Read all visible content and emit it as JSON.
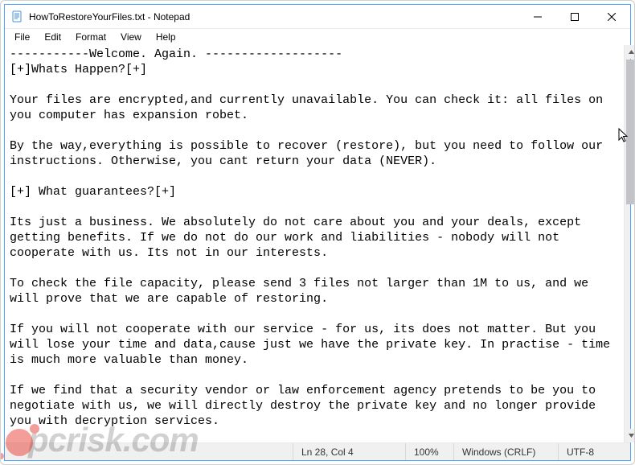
{
  "title": "HowToRestoreYourFiles.txt - Notepad",
  "menu": {
    "file": "File",
    "edit": "Edit",
    "format": "Format",
    "view": "View",
    "help": "Help"
  },
  "document_text": "-----------Welcome. Again. -------------------\n[+]Whats Happen?[+]\n\nYour files are encrypted,and currently unavailable. You can check it: all files on you computer has expansion robet.\n\nBy the way,everything is possible to recover (restore), but you need to follow our instructions. Otherwise, you cant return your data (NEVER).\n\n[+] What guarantees?[+]\n\nIts just a business. We absolutely do not care about you and your deals, except getting benefits. If we do not do our work and liabilities - nobody will not cooperate with us. Its not in our interests.\n\nTo check the file capacity, please send 3 files not larger than 1M to us, and we will prove that we are capable of restoring.\n\nIf you will not cooperate with our service - for us, its does not matter. But you will lose your time and data,cause just we have the private key. In practise - time is much more valuable than money.\n\nIf we find that a security vendor or law enforcement agency pretends to be you to negotiate with us, we will directly destroy the private key and no longer provide you with decryption services.",
  "status": {
    "position": "Ln 28, Col 4",
    "zoom": "100%",
    "line_ending": "Windows (CRLF)",
    "encoding": "UTF-8"
  },
  "watermark": "pcrisk.com"
}
